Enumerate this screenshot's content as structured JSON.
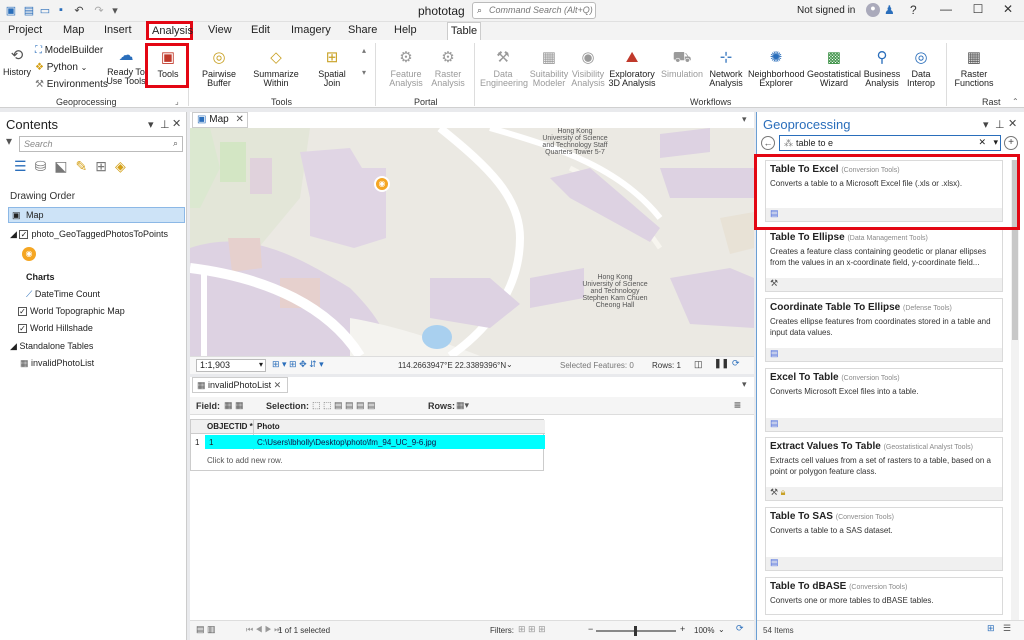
{
  "app": {
    "title": "phototag",
    "command_search_placeholder": "Command Search (Alt+Q)",
    "signed_in": "Not signed in"
  },
  "tabs": [
    "Project",
    "Map",
    "Insert",
    "Analysis",
    "View",
    "Edit",
    "Imagery",
    "Share",
    "Help",
    "Table"
  ],
  "ribbon": {
    "geoprocessing": {
      "history": "History",
      "modelbuilder": "ModelBuilder",
      "python": "Python",
      "environments": "Environments",
      "ready_to_use": "Ready To Use Tools",
      "tools": "Tools",
      "group": "Geoprocessing"
    },
    "tools_group": {
      "pairwise_buffer": "Pairwise Buffer",
      "summarize_within": "Summarize Within",
      "spatial_join": "Spatial Join",
      "group": "Tools"
    },
    "portal": {
      "feature_analysis": "Feature Analysis",
      "raster_analysis": "Raster Analysis",
      "group": "Portal"
    },
    "workflows": {
      "data_engineering": "Data Engineering",
      "suitability_modeler": "Suitability Modeler",
      "visibility_analysis": "Visibility Analysis",
      "exploratory_3d": "Exploratory 3D Analysis",
      "simulation": "Simulation",
      "network_analysis": "Network Analysis",
      "neighborhood_explorer": "Neighborhood Explorer",
      "geostatistical_wizard": "Geostatistical Wizard",
      "business_analysis": "Business Analysis",
      "data_interop": "Data Interop",
      "group": "Workflows"
    },
    "raster": {
      "raster_functions": "Raster Functions",
      "group": "Rast"
    }
  },
  "contents": {
    "title": "Contents",
    "search_placeholder": "Search",
    "drawing_order": "Drawing Order",
    "items": [
      {
        "label": "Map"
      },
      {
        "label": "photo_GeoTaggedPhotosToPoints"
      },
      {
        "label": "Charts"
      },
      {
        "label": "DateTime Count"
      },
      {
        "label": "World Topographic Map"
      },
      {
        "label": "World Hillshade"
      },
      {
        "label": "Standalone Tables"
      },
      {
        "label": "invalidPhotoList"
      }
    ]
  },
  "map": {
    "tab": "Map",
    "labels": {
      "label1": "Hong Kong University of Science and Technology Staff Quarters Tower 5-7",
      "label2": "Hong Kong University of Science and Technology Stephen Kam Chuen Cheong Hall"
    },
    "scale": "1:1,903",
    "coords": "114.2663947°E 22.3389396°N",
    "selected_features": "Selected Features: 0",
    "rows": "Rows: 1"
  },
  "table": {
    "tab": "invalidPhotoList",
    "field_label": "Field:",
    "selection_label": "Selection:",
    "rows_label": "Rows:",
    "columns": [
      "OBJECTID *",
      "Photo"
    ],
    "rows": [
      {
        "num": "1",
        "objectid": "1",
        "photo": "C:\\Users\\lbholly\\Desktop\\photo\\fm_94_UC_9-6.jpg"
      }
    ],
    "add_row": "Click to add new row.",
    "selection_status": "1 of 1 selected",
    "filters": "Filters:",
    "zoom": "100%"
  },
  "geoprocessing": {
    "title": "Geoprocessing",
    "search_value": "table to e",
    "results": [
      {
        "title": "Table To Excel",
        "toolbox": "(Conversion Tools)",
        "desc": "Converts  a table to a Microsoft Excel file (.xls or .xlsx)."
      },
      {
        "title": "Table To Ellipse",
        "toolbox": "(Data Management Tools)",
        "desc": "Creates a feature class containing geodetic or planar ellipses from the values in an x-coordinate field, y-coordinate field..."
      },
      {
        "title": "Coordinate Table To Ellipse",
        "toolbox": "(Defense Tools)",
        "desc": "Creates ellipse features from coordinates stored in a table and input data values."
      },
      {
        "title": "Excel To Table",
        "toolbox": "(Conversion Tools)",
        "desc": "Converts Microsoft Excel files into a table."
      },
      {
        "title": "Extract Values To Table",
        "toolbox": "(Geostatistical Analyst Tools)",
        "desc": "Extracts cell values from a set of rasters to a table, based on a point or polygon feature class."
      },
      {
        "title": "Table To SAS",
        "toolbox": "(Conversion Tools)",
        "desc": "Converts a table to a SAS dataset."
      },
      {
        "title": "Table To dBASE",
        "toolbox": "(Conversion Tools)",
        "desc": "Converts one or more tables to dBASE tables."
      }
    ],
    "count": "54 Items"
  },
  "colors": {
    "highlight": "#e30613",
    "accent": "#2a6ebb",
    "selected_row": "#00ffff"
  }
}
